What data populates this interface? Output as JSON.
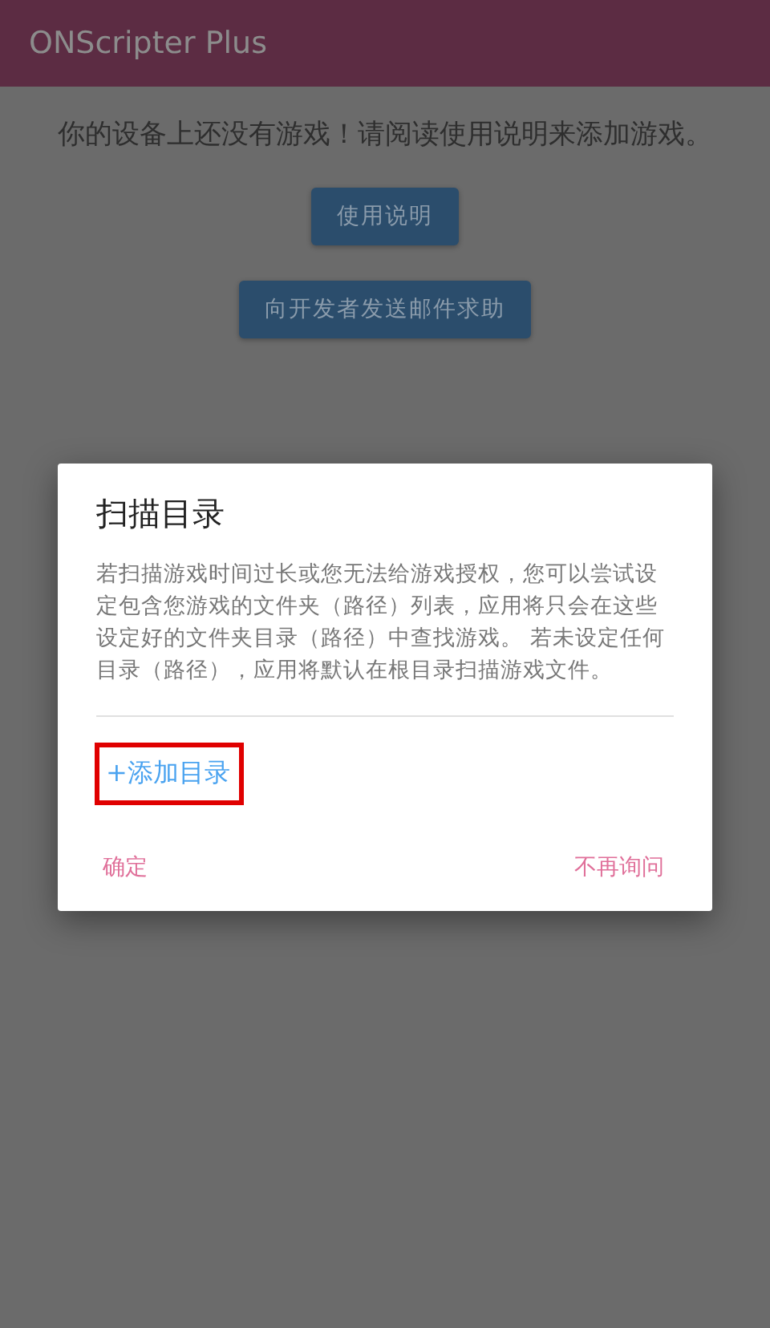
{
  "app_bar": {
    "title": "ONScripter Plus"
  },
  "empty_message": "你的设备上还没有游戏！请阅读使用说明来添加游戏。",
  "buttons": [
    "使用说明",
    "向开发者发送邮件求助"
  ],
  "dialog": {
    "title": "扫描目录",
    "message": "若扫描游戏时间过长或您无法给游戏授权，您可以尝试设定包含您游戏的文件夹（路径）列表，应用将只会在这些设定好的文件夹目录（路径）中查找游戏。 若未设定任何目录（路径），应用将默认在根目录扫描游戏文件。",
    "add_directory": {
      "label": "+添加目录",
      "highlighted": true
    },
    "actions": [
      {
        "label": "确定",
        "kind": "positive"
      },
      {
        "label": "不再询问",
        "kind": "neutral"
      }
    ]
  }
}
